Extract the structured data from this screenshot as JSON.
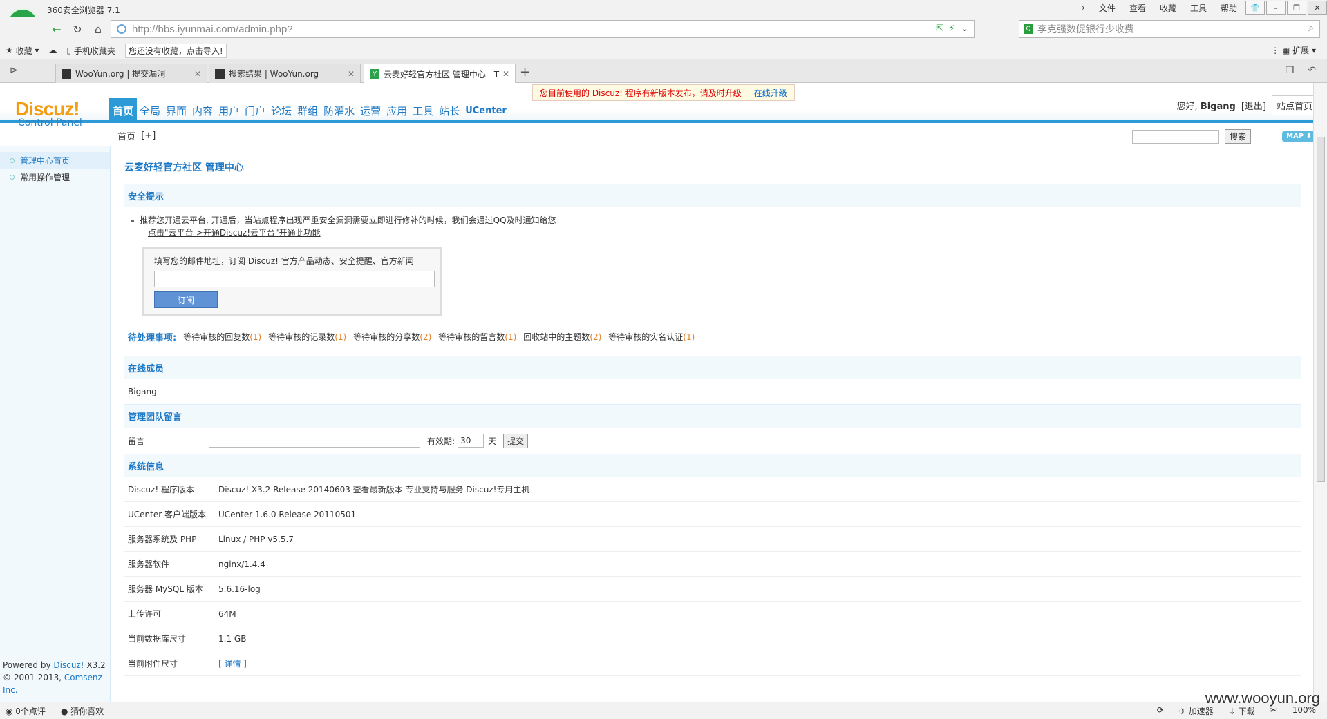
{
  "browser": {
    "app_title": "360安全浏览器 7.1",
    "menu": [
      "文件",
      "查看",
      "收藏",
      "工具",
      "帮助"
    ],
    "url": "http://bbs.iyunmai.com/admin.php?",
    "search_placeholder": "李克强数促银行少收费",
    "favorites": {
      "collect": "收藏",
      "mobile": "手机收藏夹",
      "hint": "您还没有收藏，点击导入!"
    },
    "ext_label": "扩展",
    "tabs": [
      {
        "label": "WooYun.org | 提交漏洞"
      },
      {
        "label": "搜索结果 | WooYun.org"
      },
      {
        "label": "云麦好轻官方社区 管理中心 - T"
      }
    ],
    "status": {
      "comments": "0个点评",
      "guess": "猜你喜欢",
      "accelerator": "加速器",
      "download": "下载",
      "zoom": "100%"
    }
  },
  "discuz": {
    "brand": "Discuz!",
    "brand_sub": "Control Panel",
    "nav": [
      "首页",
      "全局",
      "界面",
      "内容",
      "用户",
      "门户",
      "论坛",
      "群组",
      "防灌水",
      "运营",
      "应用",
      "工具",
      "站长",
      "UCenter"
    ],
    "notice": {
      "message": "您目前使用的 Discuz! 程序有新版本发布，请及时升级",
      "link": "在线升级"
    },
    "user": {
      "greeting": "您好,",
      "name": "Bigang",
      "logout": "[退出]",
      "site_home": "站点首页"
    },
    "breadcrumb": "首页",
    "breadcrumb_add": "[+]",
    "search_button": "搜索",
    "map_button": "MAP",
    "sidebar": [
      {
        "label": "管理中心首页"
      },
      {
        "label": "常用操作管理"
      }
    ],
    "footer": {
      "powered_prefix": "Powered by",
      "powered_brand": "Discuz!",
      "powered_version": "X3.2",
      "copyright_prefix": "© 2001-2013,",
      "copyright_company": "Comsenz Inc."
    },
    "page_title": "云麦好轻官方社区 管理中心",
    "security": {
      "heading": "安全提示",
      "tip": "推荐您开通云平台, 开通后，当站点程序出现严重安全漏洞需要立即进行修补的时候，我们会通过QQ及时通知给您",
      "tip_link": "点击\"云平台->开通Discuz!云平台\"开通此功能",
      "subscribe_label": "填写您的邮件地址，订阅 Discuz! 官方产品动态、安全提醒、官方新闻",
      "subscribe_button": "订阅"
    },
    "todo": {
      "label": "待处理事项:",
      "items": [
        {
          "text": "等待审核的回复数",
          "count": "(1)"
        },
        {
          "text": "等待审核的记录数",
          "count": "(1)"
        },
        {
          "text": "等待审核的分享数",
          "count": "(2)"
        },
        {
          "text": "等待审核的留言数",
          "count": "(1)"
        },
        {
          "text": "回收站中的主题数",
          "count": "(2)"
        },
        {
          "text": "等待审核的实名认证",
          "count": "(1)"
        }
      ]
    },
    "online": {
      "heading": "在线成员",
      "member": "Bigang"
    },
    "team_msg": {
      "heading": "管理团队留言",
      "label": "留言",
      "expiry_label": "有效期:",
      "expiry_value": "30",
      "unit": "天",
      "submit": "提交"
    },
    "sysinfo": {
      "heading": "系统信息",
      "rows": [
        {
          "label": "Discuz! 程序版本",
          "value": "Discuz! X3.2 Release 20140603 查看最新版本 专业支持与服务 Discuz!专用主机"
        },
        {
          "label": "UCenter 客户端版本",
          "value": "UCenter 1.6.0 Release 20110501"
        },
        {
          "label": "服务器系统及 PHP",
          "value": "Linux / PHP v5.5.7"
        },
        {
          "label": "服务器软件",
          "value": "nginx/1.4.4"
        },
        {
          "label": "服务器 MySQL 版本",
          "value": "5.6.16-log"
        },
        {
          "label": "上传许可",
          "value": "64M"
        },
        {
          "label": "当前数据库尺寸",
          "value": "1.1 GB"
        },
        {
          "label": "当前附件尺寸",
          "value": "[ 详情 ]"
        }
      ]
    }
  },
  "watermark": "www.wooyun.org",
  "colors": {
    "accent": "#2b9ad6",
    "brand": "#f39c12",
    "alert": "#dd0000"
  }
}
